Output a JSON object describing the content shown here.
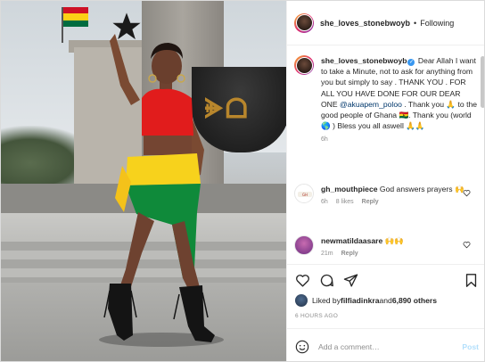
{
  "post": {
    "username": "she_loves_stonebwoyb",
    "follow_status": "Following",
    "separator": "•"
  },
  "caption": {
    "username": "she_loves_stonebwoyb",
    "text_1": " Dear Allah I want to take a Minute, not to ask for anything from you but simply to say . THANK YOU . FOR ALL YOU HAVE DONE FOR OUR DEAR ONE ",
    "mention": "@akuapem_poloo",
    "text_2": " . Thank you 🙏 to the good people of Ghana 🇬🇭. Thank you (world 🌎 ) Bless you all aswell 🙏🙏",
    "time": "6h"
  },
  "comments": [
    {
      "username": "gh_mouthpiece",
      "text": " God answers prayers 🙌",
      "time": "6h",
      "likes": "8 likes",
      "reply": "Reply"
    },
    {
      "username": "newmatildaasare",
      "text": " 🙌🙌",
      "time": "21m",
      "reply": "Reply"
    }
  ],
  "icons": {
    "like": "heart-icon",
    "comment": "comment-icon",
    "share": "share-icon",
    "save": "bookmark-icon",
    "emoji": "smiley-icon"
  },
  "likes": {
    "prefix": "Liked by ",
    "user": "filfiadinkra",
    "middle": " and ",
    "others": "6,890 others"
  },
  "post_time": "6 HOURS AGO",
  "composer": {
    "placeholder": "Add a comment…",
    "post_label": "Post"
  },
  "colors": {
    "link": "#00376b",
    "verified": "#3897f0",
    "post_disabled": "#b2dffc",
    "muted": "#8e8e8e"
  }
}
